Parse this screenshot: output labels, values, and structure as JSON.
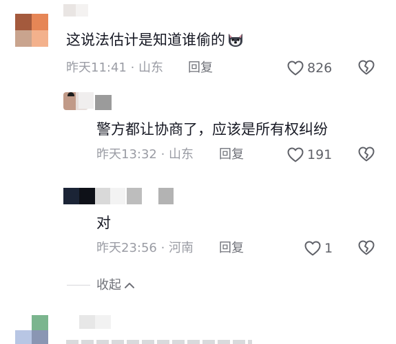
{
  "comments": [
    {
      "text": "这说法估计是知道谁偷的",
      "emoji_icon": "dog-face-emoji-icon",
      "meta": "昨天11:41 · 山东",
      "reply_label": "回复",
      "likes": "826",
      "colors": [
        "#a85c3e",
        "#e88658",
        "#f6b08a",
        "#caa28c",
        "#e08c66",
        "#f4d2bd"
      ]
    },
    {
      "text": "警方都让协商了，应该是所有权纠纷",
      "meta": "昨天13:32 · 山东",
      "reply_label": "回复",
      "likes": "191"
    },
    {
      "text": "对",
      "meta": "昨天23:56 · 河南",
      "reply_label": "回复",
      "likes": "1"
    }
  ],
  "collapse_label": "收起",
  "accent_colors": {
    "text": "#161823",
    "meta": "#9a9ca4",
    "icon": "#5f6168"
  }
}
